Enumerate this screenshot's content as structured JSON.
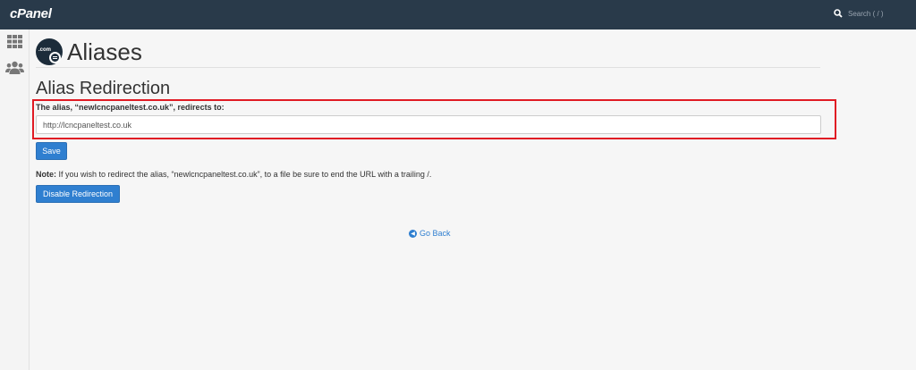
{
  "header": {
    "logo": "cPanel",
    "search_placeholder": "Search ( / )"
  },
  "page": {
    "icon_text": ".com",
    "title": "Aliases",
    "section_title": "Alias Redirection"
  },
  "form": {
    "label": "The alias, “newlcncpaneltest.co.uk”, redirects to:",
    "url_value": "http://lcncpaneltest.co.uk",
    "save_label": "Save"
  },
  "note": {
    "prefix": "Note:",
    "text": " If you wish to redirect the alias, “newlcncpaneltest.co.uk”, to a file be sure to end the URL with a trailing /."
  },
  "disable_label": "Disable Redirection",
  "go_back_label": "Go Back",
  "colors": {
    "topbar": "#293a4a",
    "accent": "#2f7fd0",
    "highlight": "#e01b24"
  }
}
